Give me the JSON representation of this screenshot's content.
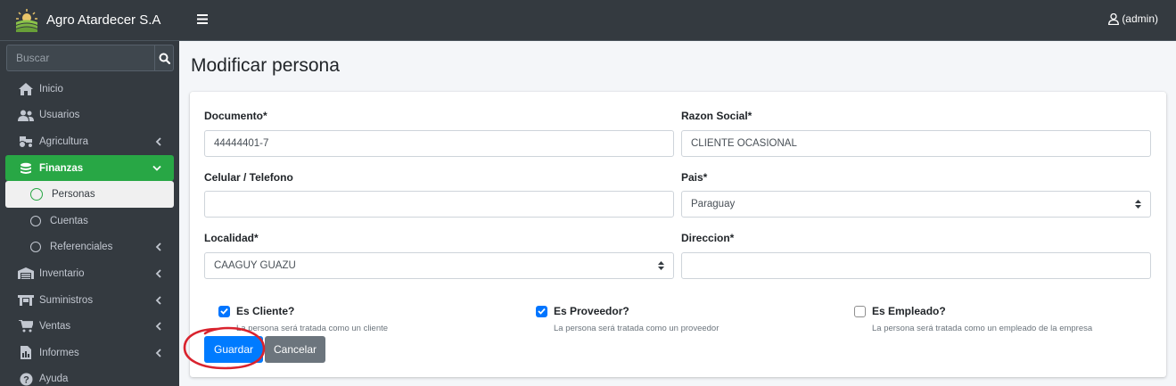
{
  "brand": {
    "name": "Agro Atardecer S.A"
  },
  "search": {
    "placeholder": "Buscar"
  },
  "sidebar": {
    "items": [
      {
        "label": "Inicio",
        "icon": "home-icon"
      },
      {
        "label": "Usuarios",
        "icon": "users-icon"
      },
      {
        "label": "Agricultura",
        "icon": "tractor-icon"
      },
      {
        "label": "Finanzas",
        "icon": "coins-icon"
      },
      {
        "label": "Personas"
      },
      {
        "label": "Cuentas"
      },
      {
        "label": "Referenciales"
      },
      {
        "label": "Inventario",
        "icon": "warehouse-icon"
      },
      {
        "label": "Suministros",
        "icon": "dolly-icon"
      },
      {
        "label": "Ventas",
        "icon": "cart-icon"
      },
      {
        "label": "Informes",
        "icon": "report-icon"
      },
      {
        "label": "Ayuda",
        "icon": "help-icon"
      }
    ]
  },
  "topbar": {
    "user": "(admin)"
  },
  "page": {
    "title": "Modificar persona"
  },
  "form": {
    "documento": {
      "label": "Documento*",
      "value": "44444401-7"
    },
    "razon_social": {
      "label": "Razon Social*",
      "value": "CLIENTE OCASIONAL"
    },
    "celular": {
      "label": "Celular / Telefono",
      "value": ""
    },
    "pais": {
      "label": "Pais*",
      "value": "Paraguay"
    },
    "localidad": {
      "label": "Localidad*",
      "value": "CAAGUY GUAZU"
    },
    "direccion": {
      "label": "Direccion*",
      "value": ""
    },
    "es_cliente": {
      "label": "Es Cliente?",
      "hint": "La persona será tratada como un cliente",
      "checked": true
    },
    "es_proveedor": {
      "label": "Es Proveedor?",
      "hint": "La persona será tratada como un proveedor",
      "checked": true
    },
    "es_empleado": {
      "label": "Es Empleado?",
      "hint": "La persona será tratada como un empleado de la empresa",
      "checked": false
    },
    "save_label": "Guardar",
    "cancel_label": "Cancelar"
  },
  "colors": {
    "sidebar": "#343a40",
    "active": "#28a745",
    "primary": "#007bff",
    "secondary": "#6c757d",
    "annotation": "#d9232e"
  }
}
